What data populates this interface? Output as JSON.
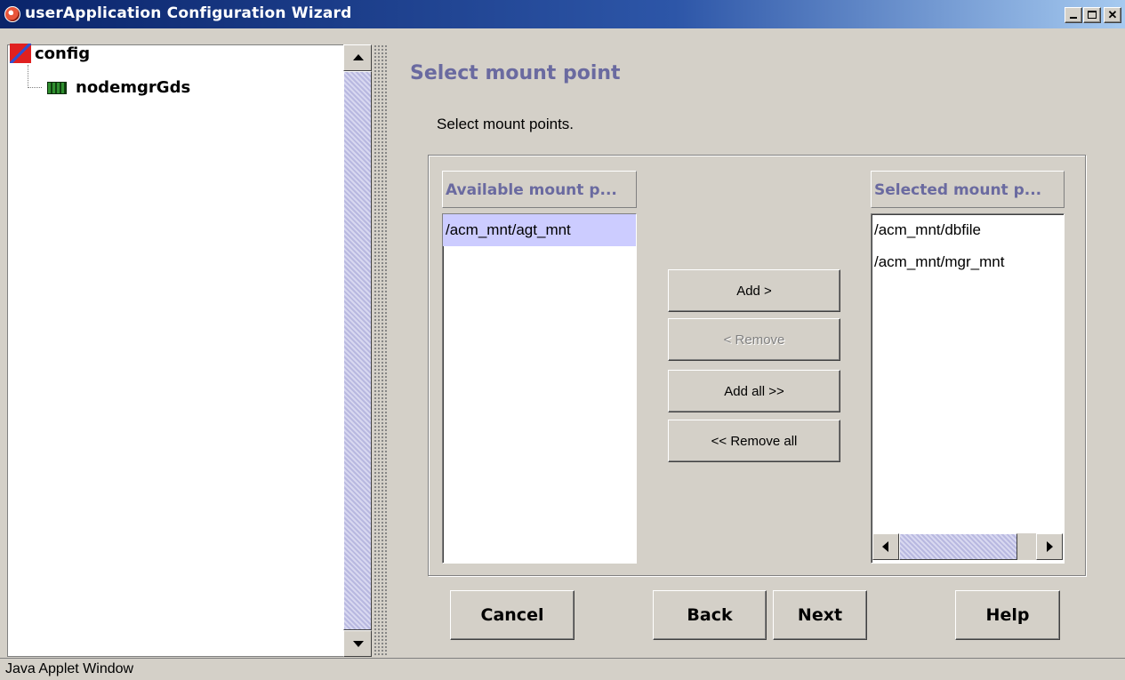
{
  "window": {
    "title": "userApplication Configuration Wizard"
  },
  "tree": {
    "root_label": "config",
    "child_label": "nodemgrGds"
  },
  "page": {
    "heading": "Select mount point",
    "instruction": "Select mount points."
  },
  "available": {
    "header": "Available mount p...",
    "items": [
      "/acm_mnt/agt_mnt"
    ],
    "selected_index": 0
  },
  "selected": {
    "header": "Selected mount p...",
    "items": [
      "/acm_mnt/dbfile",
      "/acm_mnt/mgr_mnt"
    ]
  },
  "transfer_buttons": {
    "add": "Add >",
    "remove": "< Remove",
    "add_all": "Add all >>",
    "remove_all": "<< Remove all"
  },
  "nav_buttons": {
    "cancel": "Cancel",
    "back": "Back",
    "next": "Next",
    "help": "Help"
  },
  "statusbar": {
    "text": "Java Applet Window"
  },
  "colors": {
    "heading": "#6a6aa0",
    "selection": "#ccccff",
    "background": "#d4d0c8"
  }
}
